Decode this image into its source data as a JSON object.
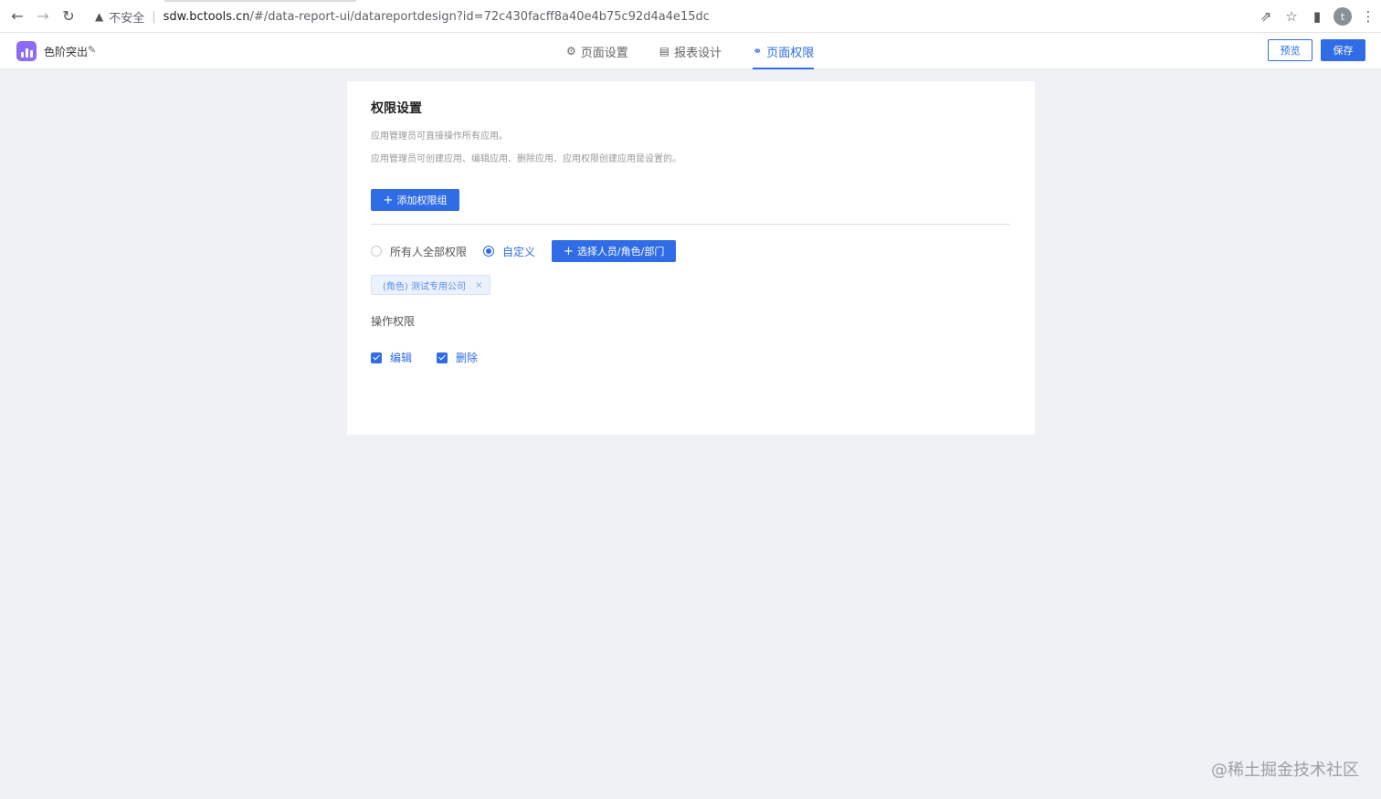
{
  "browser": {
    "insecure_label": "不安全",
    "url_host": "sdw.bctools.cn",
    "url_path": "/#/data-report-ui/datareportdesign?id=72c430facff8a40e4b75c92d4a4e15dc",
    "profile_initial": "t"
  },
  "app": {
    "title": "色阶突出",
    "tabs": [
      {
        "label": "页面设置",
        "icon": "gear-icon",
        "active": false
      },
      {
        "label": "报表设计",
        "icon": "report-icon",
        "active": false
      },
      {
        "label": "页面权限",
        "icon": "key-icon",
        "active": true
      }
    ],
    "preview_label": "预览",
    "save_label": "保存",
    "accent_color": "#2f6ce5"
  },
  "permissions": {
    "title": "权限设置",
    "desc1": "应用管理员可直接操作所有应用。",
    "desc2": "应用管理员可创建应用、编辑应用、删除应用、应用权限创建应用是设置的。",
    "add_group_label": "添加权限组",
    "radio_all_label": "所有人全部权限",
    "radio_custom_label": "自定义",
    "selected_radio": "自定义",
    "select_button_label": "选择人员/角色/部门",
    "tag_label": "(角色) 测试专用公司",
    "op_label": "操作权限",
    "checks": [
      {
        "label": "编辑",
        "checked": true
      },
      {
        "label": "删除",
        "checked": true
      }
    ]
  },
  "watermark": "@稀土掘金技术社区"
}
